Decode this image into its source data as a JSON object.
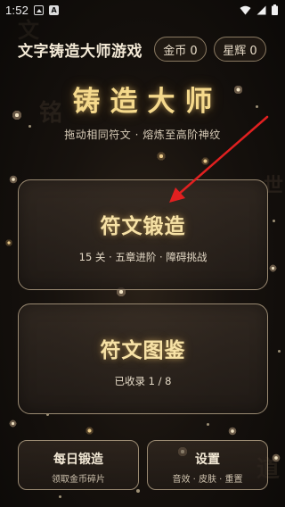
{
  "status_bar": {
    "time": "1:52"
  },
  "header": {
    "title": "文字铸造大师游戏",
    "coins_label": "金币 0",
    "stars_label": "星辉 0"
  },
  "hero": {
    "title": "铸造大师",
    "subtitle": "拖动相同符文 · 熔炼至高阶神纹"
  },
  "modes": {
    "forge": {
      "title": "符文锻造",
      "subtitle": "15 关 · 五章进阶 · 障碍挑战"
    },
    "atlas": {
      "title": "符文图鉴",
      "subtitle": "已收录 1 / 8"
    }
  },
  "bottom": {
    "daily": {
      "title": "每日锻造",
      "subtitle": "领取金币碎片"
    },
    "settings": {
      "title": "设置",
      "subtitle": "音效 · 皮肤 · 重置"
    }
  },
  "background_glyphs": [
    "铭",
    "道",
    "世",
    "文"
  ],
  "colors": {
    "gold_title": "#f5d98c",
    "card_border": "#9a8a72",
    "arrow": "#e02020",
    "background": "#17120e"
  }
}
